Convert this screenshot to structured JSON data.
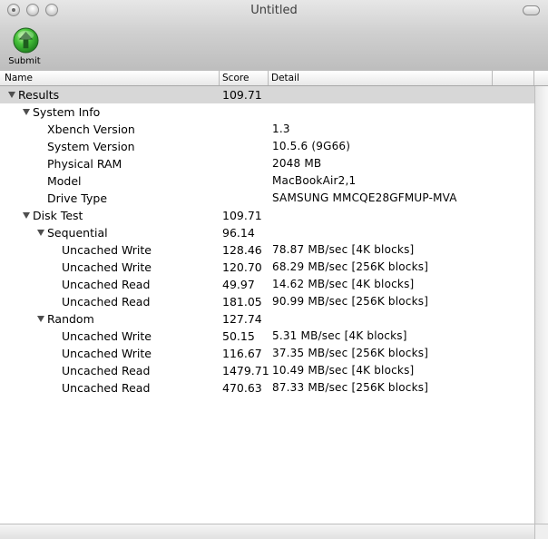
{
  "window": {
    "title": "Untitled"
  },
  "toolbar": {
    "submit_label": "Submit"
  },
  "columns": {
    "name": "Name",
    "score": "Score",
    "detail": "Detail"
  },
  "rows": [
    {
      "name": "Results",
      "score": "109.71",
      "detail": ""
    },
    {
      "name": "System Info",
      "score": "",
      "detail": ""
    },
    {
      "name": "Xbench Version",
      "score": "",
      "detail": "1.3"
    },
    {
      "name": "System Version",
      "score": "",
      "detail": "10.5.6 (9G66)"
    },
    {
      "name": "Physical RAM",
      "score": "",
      "detail": "2048 MB"
    },
    {
      "name": "Model",
      "score": "",
      "detail": "MacBookAir2,1"
    },
    {
      "name": "Drive Type",
      "score": "",
      "detail": "SAMSUNG MMCQE28GFMUP-MVA"
    },
    {
      "name": "Disk Test",
      "score": "109.71",
      "detail": ""
    },
    {
      "name": "Sequential",
      "score": "96.14",
      "detail": ""
    },
    {
      "name": "Uncached Write",
      "score": "128.46",
      "detail": "78.87 MB/sec [4K blocks]"
    },
    {
      "name": "Uncached Write",
      "score": "120.70",
      "detail": "68.29 MB/sec [256K blocks]"
    },
    {
      "name": "Uncached Read",
      "score": "49.97",
      "detail": "14.62 MB/sec [4K blocks]"
    },
    {
      "name": "Uncached Read",
      "score": "181.05",
      "detail": "90.99 MB/sec [256K blocks]"
    },
    {
      "name": "Random",
      "score": "127.74",
      "detail": ""
    },
    {
      "name": "Uncached Write",
      "score": "50.15",
      "detail": "5.31 MB/sec [4K blocks]"
    },
    {
      "name": "Uncached Write",
      "score": "116.67",
      "detail": "37.35 MB/sec [256K blocks]"
    },
    {
      "name": "Uncached Read",
      "score": "1479.71",
      "detail": "10.49 MB/sec [4K blocks]"
    },
    {
      "name": "Uncached Read",
      "score": "470.63",
      "detail": "87.33 MB/sec [256K blocks]"
    }
  ]
}
